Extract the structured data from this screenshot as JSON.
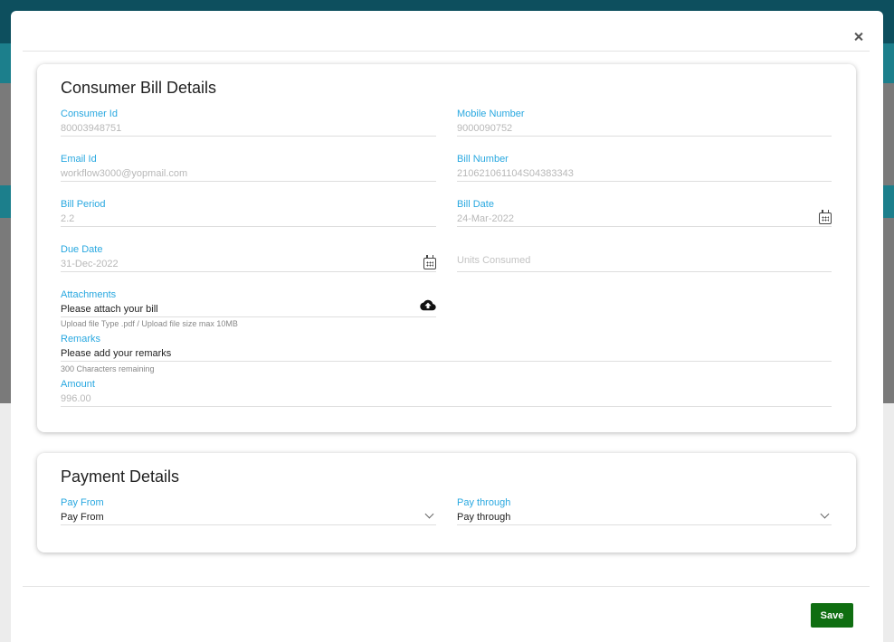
{
  "bill": {
    "title": "Consumer Bill Details",
    "consumer_id": {
      "label": "Consumer Id",
      "value": "80003948751"
    },
    "mobile": {
      "label": "Mobile Number",
      "value": "9000090752"
    },
    "email": {
      "label": "Email Id",
      "value": "workflow3000@yopmail.com"
    },
    "bill_number": {
      "label": "Bill Number",
      "value": "210621061104S04383343"
    },
    "bill_period": {
      "label": "Bill Period",
      "value": "2.2"
    },
    "bill_date": {
      "label": "Bill Date",
      "value": "24-Mar-2022"
    },
    "due_date": {
      "label": "Due Date",
      "value": "31-Dec-2022"
    },
    "units": {
      "placeholder": "Units Consumed"
    },
    "attachments": {
      "label": "Attachments",
      "value": "Please attach your bill",
      "hint": "Upload file Type .pdf / Upload file size max 10MB"
    },
    "remarks": {
      "label": "Remarks",
      "value": "Please add your remarks",
      "hint": "300 Characters remaining"
    },
    "amount": {
      "label": "Amount",
      "value": "996.00"
    }
  },
  "payment": {
    "title": "Payment Details",
    "pay_from": {
      "label": "Pay From",
      "value": "Pay From"
    },
    "pay_through": {
      "label": "Pay through",
      "value": "Pay through"
    }
  },
  "footer": {
    "save_label": "Save"
  },
  "colors": {
    "label_blue": "#29a8e0",
    "save_green": "#0f6e11",
    "header_teal": "#0d4f5e"
  }
}
